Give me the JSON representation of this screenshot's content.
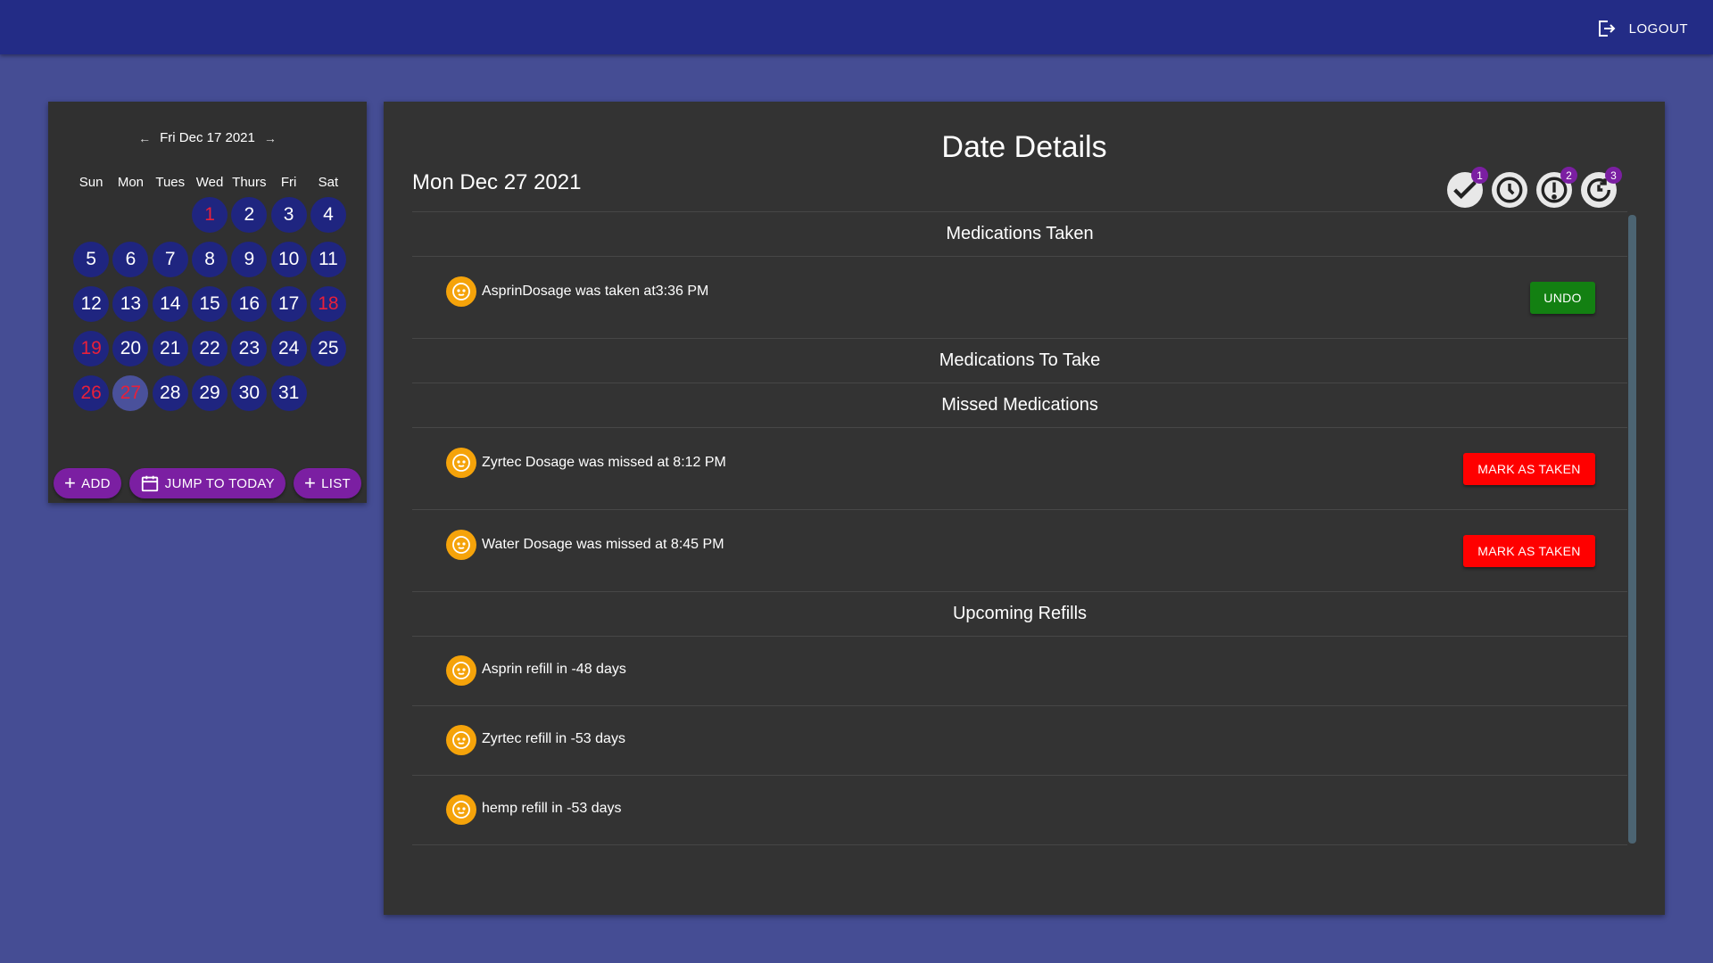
{
  "topbar": {
    "logout_label": "LOGOUT"
  },
  "calendar": {
    "nav_date": "Fri Dec 17 2021",
    "weekdays": [
      "Sun",
      "Mon",
      "Tues",
      "Wed",
      "Thurs",
      "Fri",
      "Sat"
    ],
    "days": [
      "1",
      "2",
      "3",
      "4",
      "5",
      "6",
      "7",
      "8",
      "9",
      "10",
      "11",
      "12",
      "13",
      "14",
      "15",
      "16",
      "17",
      "18",
      "19",
      "20",
      "21",
      "22",
      "23",
      "24",
      "25",
      "26",
      "27",
      "28",
      "29",
      "30",
      "31"
    ],
    "selected_day": "27",
    "buttons": {
      "add": "ADD",
      "jump": "JUMP TO TODAY",
      "list": "LIST"
    }
  },
  "details": {
    "title": "Date Details",
    "date": "Mon Dec 27 2021",
    "badges": {
      "taken": "1",
      "missed": "2",
      "refills": "3"
    },
    "sections": {
      "taken": "Medications Taken",
      "to_take": "Medications To Take",
      "missed": "Missed Medications",
      "refills": "Upcoming Refills"
    },
    "taken_items": [
      {
        "text": "AsprinDosage was taken at3:36 PM",
        "action": "UNDO"
      }
    ],
    "missed_items": [
      {
        "text": "Zyrtec Dosage was missed at 8:12 PM",
        "action": "MARK AS TAKEN"
      },
      {
        "text": "Water Dosage was missed at 8:45 PM",
        "action": "MARK AS TAKEN"
      }
    ],
    "refill_items": [
      {
        "text": "Asprin refill in -48 days"
      },
      {
        "text": "Zyrtec refill in -53 days"
      },
      {
        "text": "hemp refill in -53 days"
      }
    ]
  },
  "colors": {
    "background": "#454d94",
    "topbar": "#232c86",
    "card": "#333333",
    "day_circle": "#1f2580",
    "weekend_text": "#e8203a",
    "accent_purple": "#7b1fa2",
    "undo_green": "#138012",
    "mark_red": "#ff0000",
    "avatar_orange": "#f5a30a"
  }
}
